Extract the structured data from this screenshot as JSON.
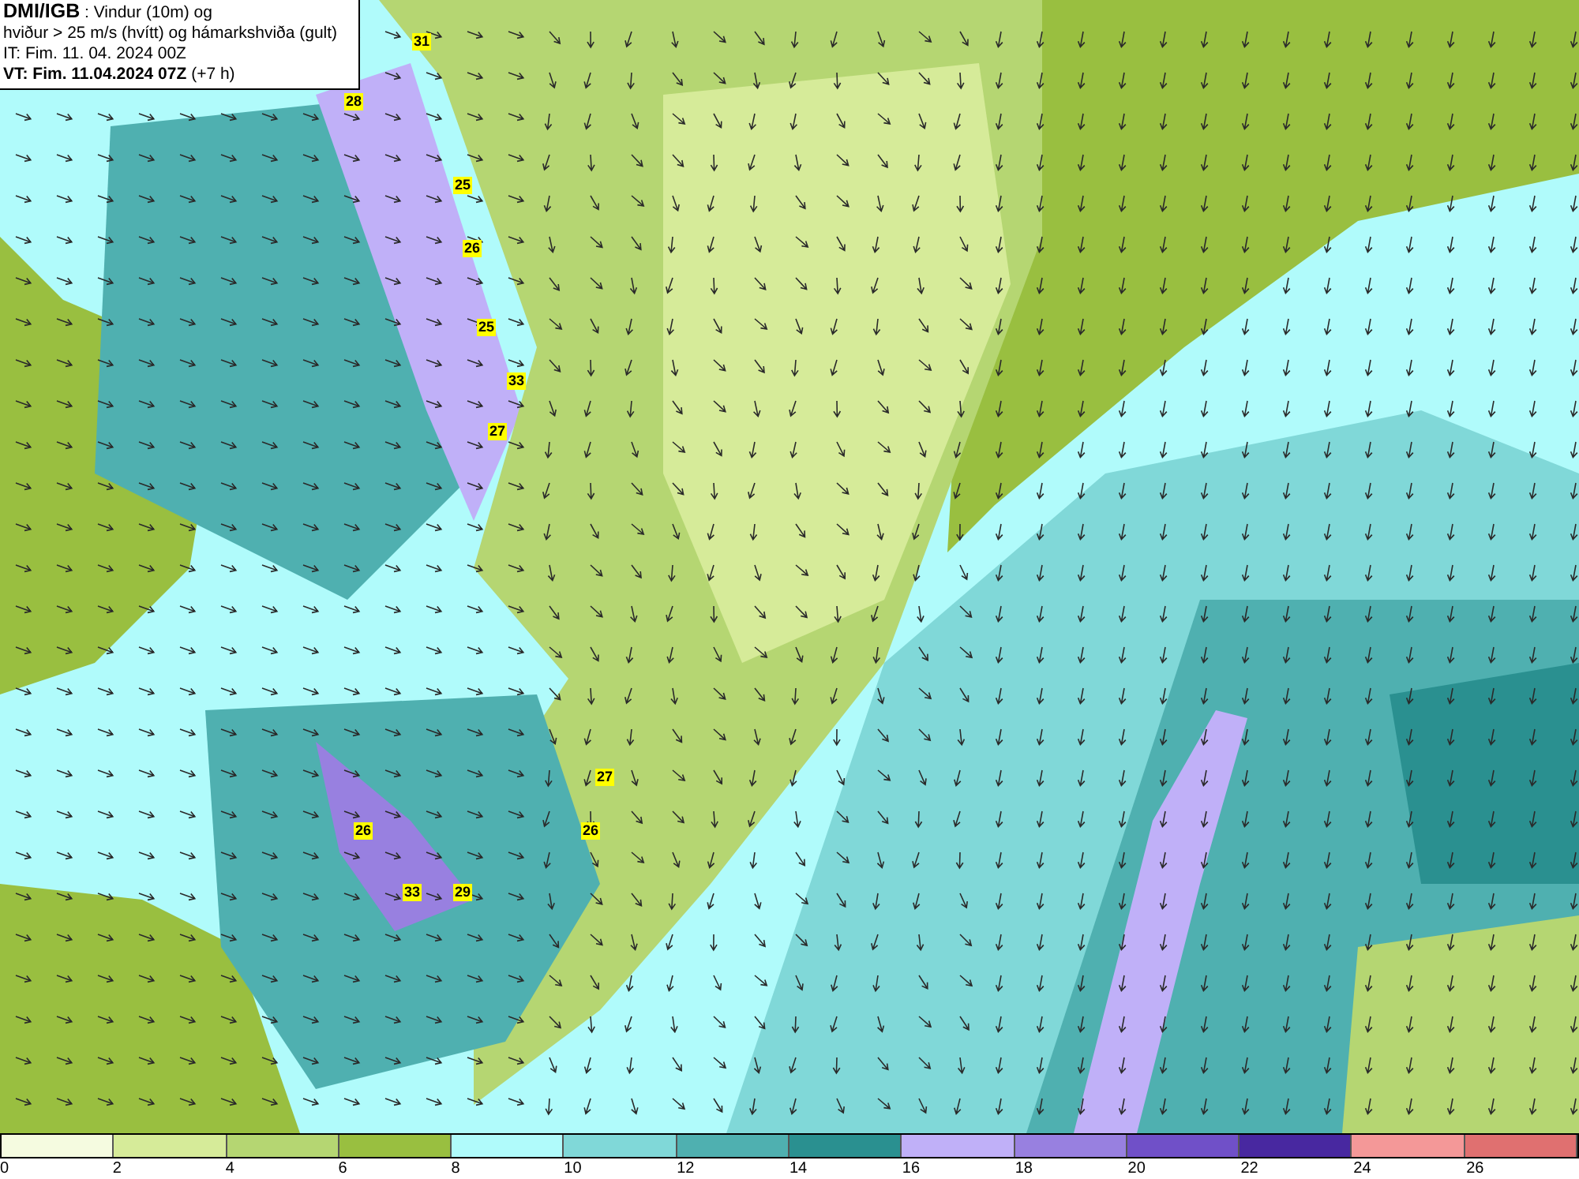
{
  "header": {
    "source": "DMI/IGB",
    "title": " : Vindur (10m) og",
    "subtitle": "hviður > 25 m/s (hvítt) og hámarkshviða (gult)",
    "issue_time": "IT: Fim. 11. 04. 2024 00Z",
    "valid_time": "VT: Fim. 11.04.2024 07Z",
    "lead": " (+7 h)"
  },
  "gust_labels": [
    "31",
    "28",
    "25",
    "26",
    "25",
    "33",
    "27",
    "27",
    "26",
    "26",
    "33",
    "29"
  ],
  "colorbar": {
    "colors": [
      {
        "color": "#f5fbe0"
      },
      {
        "color": "#d6eb99"
      },
      {
        "color": "#b5d672"
      },
      {
        "color": "#99bf40"
      },
      {
        "color": "#b0fbfb"
      },
      {
        "color": "#80d8d8"
      },
      {
        "color": "#4fb0b0"
      },
      {
        "color": "#2a9090"
      },
      {
        "color": "#c0b0f8"
      },
      {
        "color": "#9880e0"
      },
      {
        "color": "#7050c8"
      },
      {
        "color": "#4828a0"
      },
      {
        "color": "#f49898"
      },
      {
        "color": "#e07070"
      }
    ],
    "ticks": [
      "0",
      "2",
      "4",
      "6",
      "8",
      "10",
      "12",
      "14",
      "16",
      "18",
      "20",
      "22",
      "24",
      "26"
    ]
  }
}
